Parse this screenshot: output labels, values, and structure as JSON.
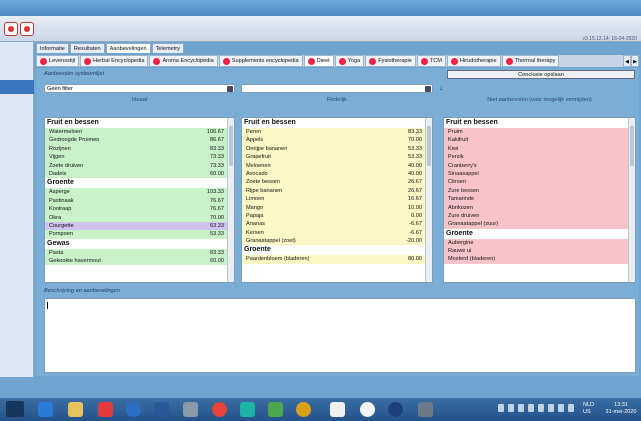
{
  "version": "v3.15.12.14; 16-04-2020",
  "subtabs": [
    "Informatie",
    "Resultaten",
    "Aanbevelingen",
    "Telemetry"
  ],
  "tabs": [
    "Levensstijl",
    "Herbal Encyclopedia",
    "Aroma Encyclopedia",
    "Supplements encyclopedia",
    "Dieet",
    "Yoga",
    "Fysiotherapie",
    "TCM",
    "Hirudotherapie",
    "Thermal therapy"
  ],
  "section_title": "Aanbevolen systeemlijst",
  "save_button": "Conclusie opslaan",
  "filter1_value": "Geen filter",
  "filter2_value": "",
  "columns": {
    "col1": "Ideaal",
    "col2": "Redelijk",
    "col3": "Niet aanbevolen (voor mogelijk vermijden)"
  },
  "list1": {
    "group1": "Fruit en bessen",
    "items1": [
      {
        "name": "Watermeloen",
        "value": "106.67"
      },
      {
        "name": "Gedroogde Pruimen",
        "value": "86.67"
      },
      {
        "name": "Rozijnen",
        "value": "83.33"
      },
      {
        "name": "Vijgen",
        "value": "73.33"
      },
      {
        "name": "Zoete druiven",
        "value": "73.33"
      },
      {
        "name": "Dadels",
        "value": "60.00"
      }
    ],
    "group2": "Groente",
    "items2": [
      {
        "name": "Asperge",
        "value": "103.33"
      },
      {
        "name": "Pastinaak",
        "value": "76.67"
      },
      {
        "name": "Koolraap",
        "value": "76.67"
      },
      {
        "name": "Okra",
        "value": "70.00"
      },
      {
        "name": "Courgette",
        "value": "63.33"
      },
      {
        "name": "Pompoen",
        "value": "53.33"
      }
    ],
    "group3": "Gewas",
    "items3": [
      {
        "name": "Pasta",
        "value": "83.33"
      },
      {
        "name": "Gekookte havermout",
        "value": "60.00"
      }
    ]
  },
  "list2": {
    "group1": "Fruit en bessen",
    "items1": [
      {
        "name": "Peren",
        "value": "83.33"
      },
      {
        "name": "Appels",
        "value": "70.00"
      },
      {
        "name": "Onrijpe bananen",
        "value": "53.33"
      },
      {
        "name": "Grapefruit",
        "value": "53.33"
      },
      {
        "name": "Meloenen",
        "value": "40.00"
      },
      {
        "name": "Avocado",
        "value": "40.00"
      },
      {
        "name": "Zoete bessen",
        "value": "26.67"
      },
      {
        "name": "Rijpe bananen",
        "value": "26.67"
      },
      {
        "name": "Limoen",
        "value": "16.67"
      },
      {
        "name": "Mango",
        "value": "10.00"
      },
      {
        "name": "Papaja",
        "value": "0.00"
      },
      {
        "name": "Ananas",
        "value": "-6.67"
      },
      {
        "name": "Kersen",
        "value": "-6.67"
      },
      {
        "name": "Granaatappel (zoet)",
        "value": "-20.00"
      }
    ],
    "group2": "Groente",
    "items2": [
      {
        "name": "Paardenbloem (bladeren)",
        "value": "80.00"
      }
    ]
  },
  "list3": {
    "group1": "Fruit en bessen",
    "items1": [
      "Pruim",
      "Kakifruit",
      "Kiwi",
      "Perzik",
      "Cranberry's",
      "Sinaasappel",
      "Citroen",
      "Zure bessen",
      "Tamarinde",
      "Abrikozen",
      "Zure druiven",
      "Granaatappel (zuur)"
    ],
    "group2": "Groente",
    "items2": [
      "Aubergine",
      "Rauwe ui",
      "Mosterd (bladeren)"
    ]
  },
  "description_title": "Beschrijving en aanbevelingen",
  "taskbar": {
    "lang1": "NLD",
    "lang2": "US",
    "time": "13:31",
    "date": "31-mei-2020"
  }
}
